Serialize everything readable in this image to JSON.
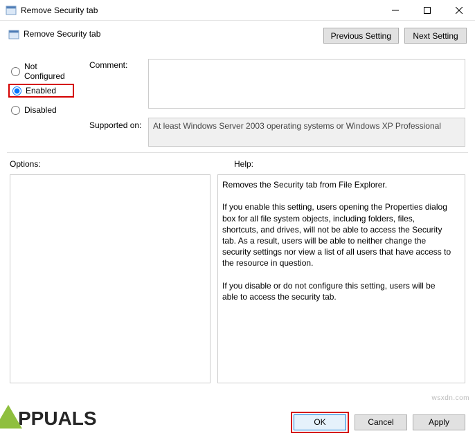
{
  "window": {
    "title": "Remove Security tab"
  },
  "header": {
    "setting_name": "Remove Security tab",
    "prev_label": "Previous Setting",
    "next_label": "Next Setting"
  },
  "state": {
    "not_configured": "Not Configured",
    "enabled": "Enabled",
    "disabled": "Disabled",
    "selected": "enabled"
  },
  "comment": {
    "label": "Comment:",
    "value": ""
  },
  "supported": {
    "label": "Supported on:",
    "value": "At least Windows Server 2003 operating systems or Windows XP Professional"
  },
  "sections": {
    "options_label": "Options:",
    "help_label": "Help:"
  },
  "help_text": "Removes the Security tab from File Explorer.\n\nIf you enable this setting, users opening the Properties dialog box for all file system objects, including folders, files, shortcuts, and drives, will not be able to access the Security tab. As a result, users will be able to neither change the security settings nor view a list of all users that have access to the resource in question.\n\nIf you disable or do not configure this setting, users will be able to access the security tab.",
  "footer": {
    "ok": "OK",
    "cancel": "Cancel",
    "apply": "Apply"
  },
  "watermark": "wsxdn.com",
  "branding": "PPUALS"
}
